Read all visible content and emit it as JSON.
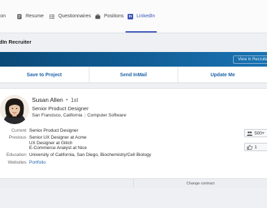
{
  "tabs": [
    {
      "label": "ation",
      "icon": "education-icon"
    },
    {
      "label": "Resume",
      "icon": "resume-icon"
    },
    {
      "label": "Questionnaires",
      "icon": "questionnaire-icon"
    },
    {
      "label": "Positions",
      "icon": "briefcase-icon"
    },
    {
      "label": "LinkedIn",
      "icon": "linkedin-icon",
      "active": true
    }
  ],
  "section_title": "dIn Recruiter",
  "linkedin_bar": {
    "view_button": "View in Recruiter"
  },
  "actions": [
    "Save to Project",
    "Send InMail",
    "Update Me"
  ],
  "profile": {
    "name": "Susan Allen",
    "degree": "1st",
    "headline": "Senior Product Designer",
    "location": "San Francisco, California",
    "industry": "Computer Software"
  },
  "details": {
    "current_label": "Current",
    "current": [
      "Senior Product Designer"
    ],
    "previous_label": "Previous",
    "previous": [
      "Senior UX Designer at Acme",
      "UX Designer at Glitch",
      "E-Commerce Analyst at Nice"
    ],
    "education_label": "Education",
    "education": [
      "University of California, San Diego, Biochemistry/Cell Biology"
    ],
    "websites_label": "Websites",
    "websites": [
      "Portfolio"
    ]
  },
  "side_pills": {
    "connections": "500+",
    "recommendations": "1"
  },
  "footer": {
    "left": "",
    "right": "Change contract"
  },
  "colors": {
    "accent": "#3a55b8",
    "link": "#1d62a8",
    "banner": "#115d95"
  }
}
